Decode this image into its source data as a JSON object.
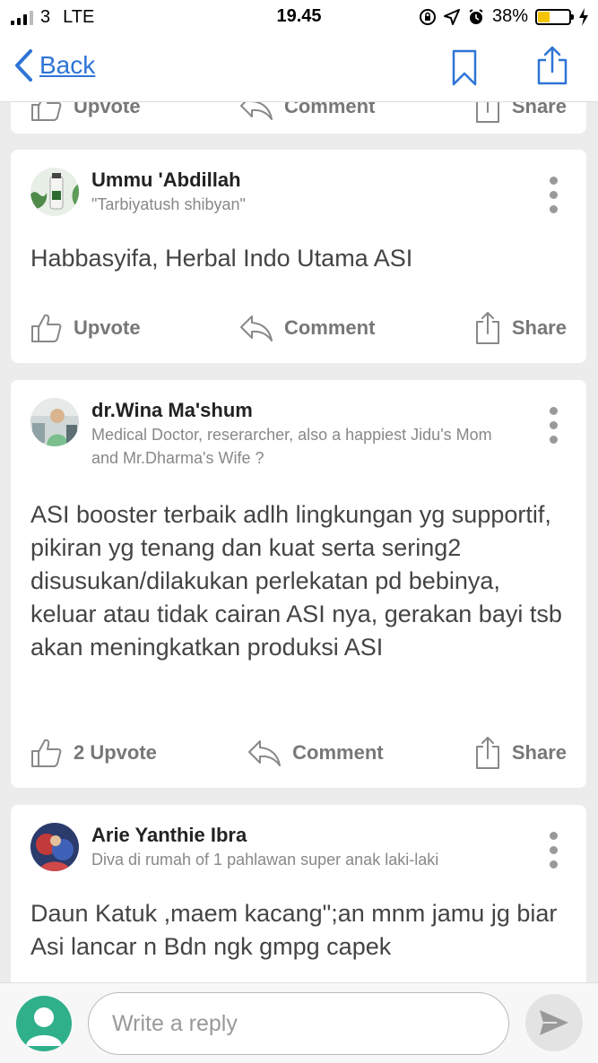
{
  "status_bar": {
    "carrier": "3",
    "network": "LTE",
    "time": "19.45",
    "battery_percent": "38%",
    "battery_level": 0.38,
    "battery_color": "#f5c400"
  },
  "nav": {
    "back_label": "Back",
    "accent_color": "#2e74d6",
    "icons": [
      "bookmark-icon",
      "share-icon"
    ]
  },
  "top_partial_card": {
    "upvote_label": "Upvote",
    "comment_label": "Comment",
    "share_label": "Share"
  },
  "answers": [
    {
      "author": "Ummu 'Abdillah",
      "credential": "\"Tarbiyatush shibyan\"",
      "text": "Habbasyifa, Herbal Indo Utama ASI",
      "upvote_label": "Upvote",
      "comment_label": "Comment",
      "share_label": "Share"
    },
    {
      "author": "dr.Wina Ma'shum",
      "credential": "Medical Doctor, reserarcher, also a happiest Jidu's Mom and Mr.Dharma's Wife ?",
      "text": "ASI booster terbaik adlh lingkungan yg supportif, pikiran yg tenang dan kuat serta sering2 disusukan/dilakukan perlekatan pd bebinya, keluar atau tidak cairan ASI nya, gerakan bayi tsb akan meningkatkan produksi ASI",
      "upvote_label": "2 Upvote",
      "comment_label": "Comment",
      "share_label": "Share"
    },
    {
      "author": "Arie Yanthie Ibra",
      "credential": "Diva di rumah of 1 pahlawan super anak laki-laki",
      "text": "Daun Katuk ,maem kacang\";an  mnm jamu jg biar Asi lancar  n Bdn ngk gmpg capek"
    }
  ],
  "reply": {
    "placeholder": "Write a reply"
  }
}
